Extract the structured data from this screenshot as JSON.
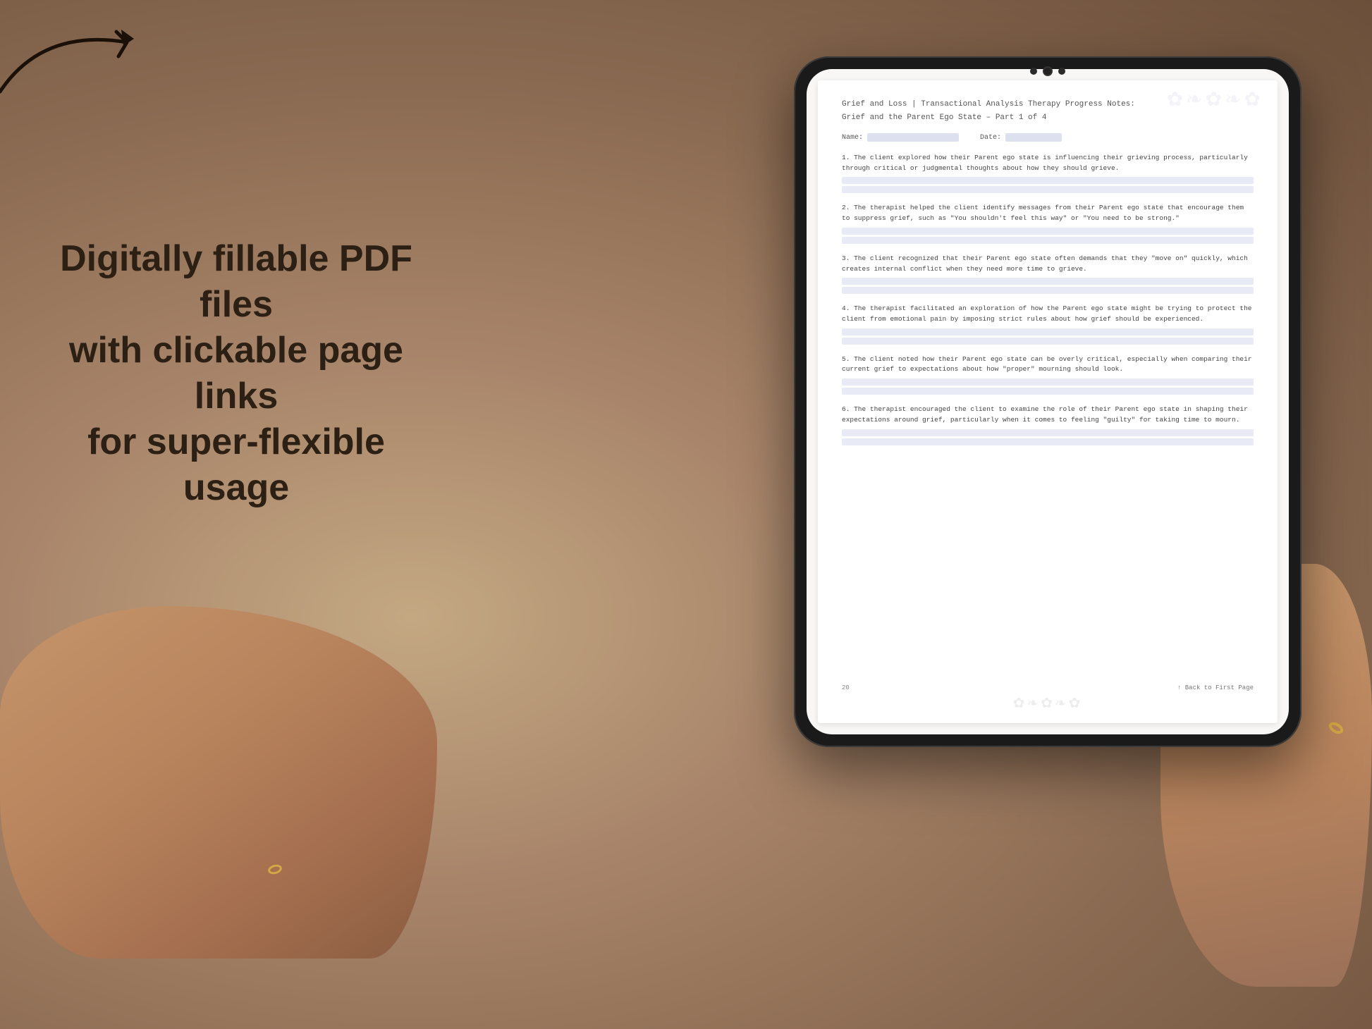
{
  "background": {
    "color": "#b89a7a"
  },
  "left_panel": {
    "tagline": "Digitally fillable PDF files\nwith clickable page links\nfor super-flexible usage"
  },
  "arrow": {
    "description": "curved arrow pointing right toward tablet"
  },
  "tablet": {
    "screen_bg": "#f8f7f5"
  },
  "pdf": {
    "title_line1": "Grief and Loss | Transactional Analysis Therapy Progress Notes:",
    "title_line2": "Grief and the Parent Ego State  – Part 1 of 4",
    "name_label": "Name:",
    "date_label": "Date:",
    "items": [
      {
        "number": "1.",
        "text": "The client explored how their Parent ego state is influencing their grieving process, particularly through critical or judgmental thoughts about how they should grieve."
      },
      {
        "number": "2.",
        "text": "The therapist helped the client identify messages from their Parent ego state that encourage them to suppress grief, such as \"You shouldn't feel this way\" or \"You need to be strong.\""
      },
      {
        "number": "3.",
        "text": "The client recognized that their Parent ego state often demands that they \"move on\" quickly, which creates internal conflict when they need more time to grieve."
      },
      {
        "number": "4.",
        "text": "The therapist facilitated an exploration of how the Parent ego state might be trying to protect the client from emotional pain by imposing strict rules about how grief should be experienced."
      },
      {
        "number": "5.",
        "text": "The client noted how their Parent ego state can be overly critical, especially when comparing their current grief to expectations about how \"proper\" mourning should look."
      },
      {
        "number": "6.",
        "text": "The therapist encouraged the client to examine the role of their Parent ego state in shaping their expectations around grief, particularly when it comes to feeling \"guilty\" for taking time to mourn."
      }
    ],
    "footer": {
      "page_number": "20",
      "back_link": "↑ Back to First Page"
    }
  }
}
